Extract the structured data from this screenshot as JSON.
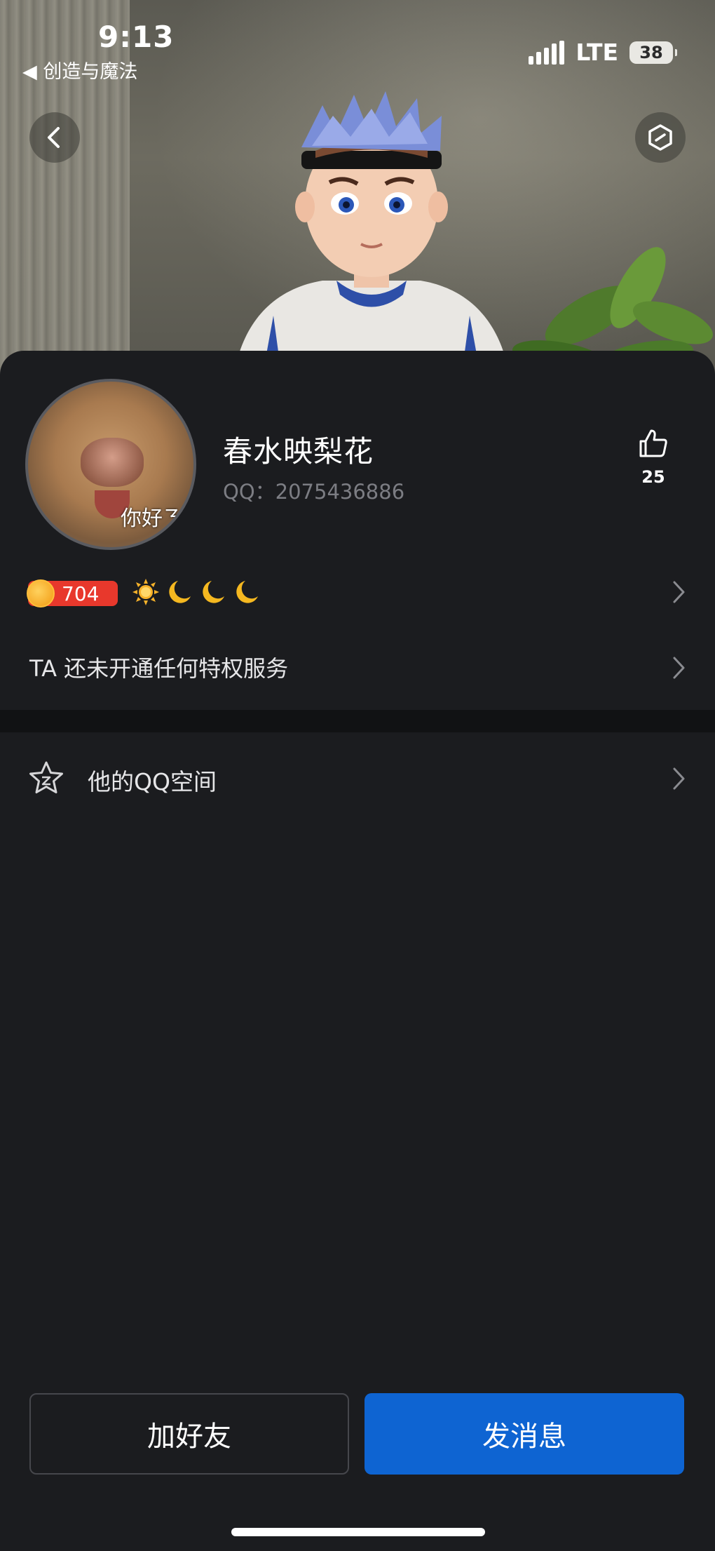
{
  "status_bar": {
    "time": "9:13",
    "back_app": "◀ 创造与魔法",
    "network": "LTE",
    "battery": "38"
  },
  "profile": {
    "avatar_caption": "你好ㄋ",
    "username": "春水映梨花",
    "qq_label": "QQ：2075436886",
    "likes": "25"
  },
  "level": {
    "coin_value": "704",
    "icons": [
      "sun-icon",
      "moon-icon",
      "moon-icon",
      "moon-icon"
    ]
  },
  "privilege": {
    "text": "TA 还未开通任何特权服务"
  },
  "qzone": {
    "label": "他的QQ空间"
  },
  "actions": {
    "add_friend": "加好友",
    "send_message": "发消息"
  },
  "colors": {
    "primary": "#0e64d2",
    "background": "#1b1c1f",
    "coin_badge": "#e8382c"
  }
}
